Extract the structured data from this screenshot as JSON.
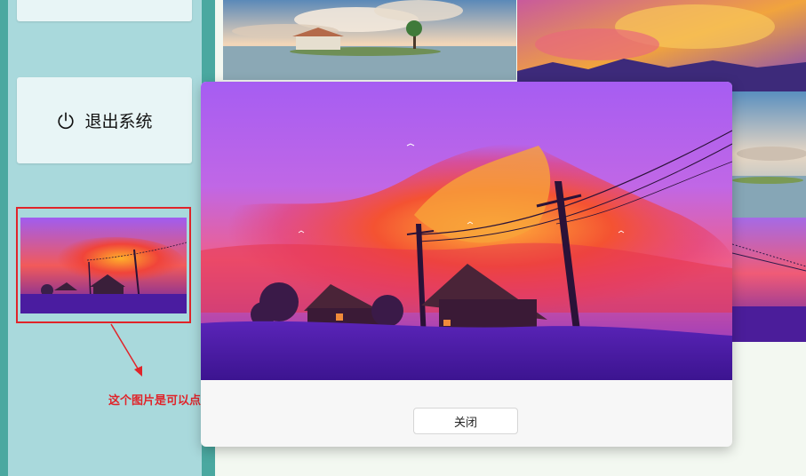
{
  "sidebar": {
    "logout_label": "退出系统"
  },
  "annotation": {
    "text": "这个图片是可以点击放大的"
  },
  "modal": {
    "close_label": "关闭"
  },
  "colors": {
    "sidebar_bg": "#a9d9dc",
    "sidebar_edge": "#4aa8a0",
    "annotation_red": "#e0242a",
    "modal_bg": "#f7f7f7"
  },
  "icons": {
    "logout": "power-icon",
    "arrow": "arrow-icon"
  }
}
